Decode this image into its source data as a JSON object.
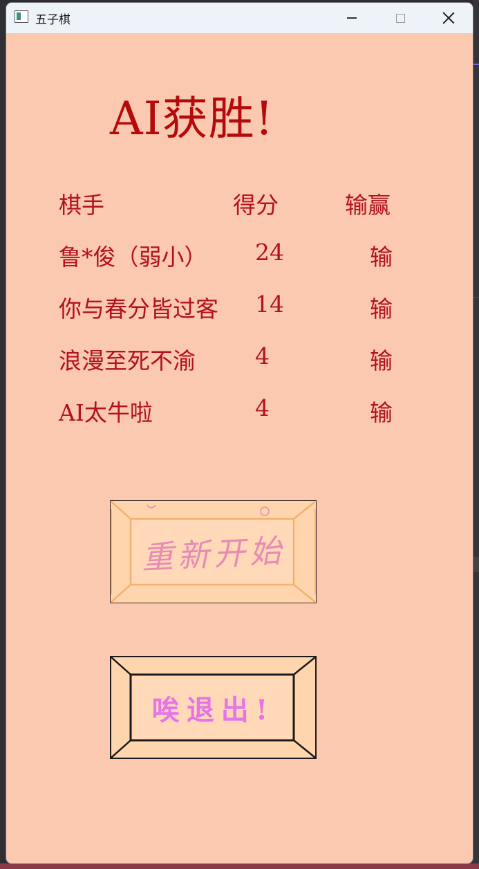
{
  "window": {
    "title": "五子棋"
  },
  "result": {
    "heading": "AI获胜!"
  },
  "table": {
    "headers": {
      "player": "棋手",
      "score": "得分",
      "result": "输赢"
    },
    "rows": [
      {
        "player": "鲁*俊（弱小）",
        "score": "24",
        "result": "输"
      },
      {
        "player": "你与春分皆过客",
        "score": "14",
        "result": "输"
      },
      {
        "player": "浪漫至死不渝",
        "score": "4",
        "result": "输"
      },
      {
        "player": "AI太牛啦",
        "score": "4",
        "result": "输"
      }
    ]
  },
  "buttons": {
    "restart_label": "重新开始",
    "exit_label": "唉退出!"
  },
  "colors": {
    "background": "#fbc8b0",
    "text": "#b2121a",
    "button_fill": "#ffd5ad",
    "restart_label": "#e78bb3",
    "exit_label": "#e674e6"
  }
}
